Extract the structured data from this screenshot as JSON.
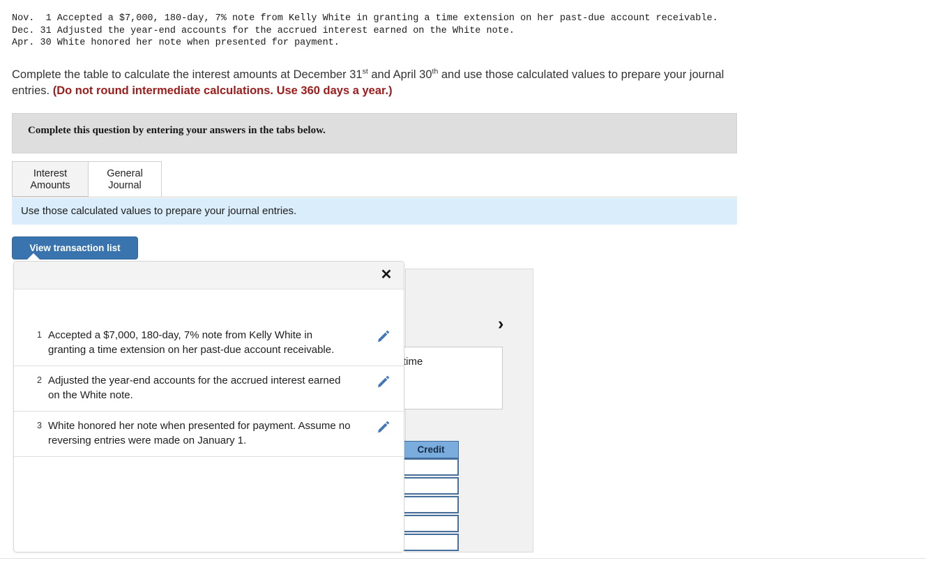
{
  "preamble": {
    "lines": [
      "Nov.  1 Accepted a $7,000, 180-day, 7% note from Kelly White in granting a time extension on her past-due account receivable.",
      "Dec. 31 Adjusted the year-end accounts for the accrued interest earned on the White note.",
      "Apr. 30 White honored her note when presented for payment."
    ],
    "full_text": "Nov.  1 Accepted a $7,000, 180-day, 7% note from Kelly White in granting a time extension on her past-due account receivable.\nDec. 31 Adjusted the year-end accounts for the accrued interest earned on the White note.\nApr. 30 White honored her note when presented for payment."
  },
  "instruction": {
    "part1": "Complete the table to calculate the interest amounts at December 31",
    "sup1": "st",
    "part2": " and April 30",
    "sup2": "th",
    "part3": " and use those calculated values to prepare your journal entries. ",
    "warning": "(Do not round intermediate calculations. Use 360 days a year.)"
  },
  "gray_callout": {
    "text": "Complete this question by entering your answers in the tabs below."
  },
  "tabs": [
    {
      "line1": "Interest",
      "line2": "Amounts",
      "active": false
    },
    {
      "line1": "General",
      "line2": "Journal",
      "active": true
    }
  ],
  "blue_bar": {
    "text": "Use those calculated values to prepare your journal entries."
  },
  "view_button": {
    "label": "View transaction list"
  },
  "popup": {
    "close_label": "✕",
    "transactions": [
      {
        "number": "1",
        "description": "Accepted a $7,000, 180-day, 7% note from Kelly White in granting a time extension on her past-due account receivable.",
        "edit_label": "edit"
      },
      {
        "number": "2",
        "description": "Adjusted the year-end accounts for the accrued interest earned on the White note.",
        "edit_label": "edit"
      },
      {
        "number": "3",
        "description": "White honored her note when presented for payment. Assume no reversing entries were made on January 1.",
        "edit_label": "edit"
      }
    ]
  },
  "journal_panel": {
    "chevron": "›",
    "textbox_value": "time",
    "credit_header": "Credit",
    "credit_cell_count": 5,
    "credit_cells": [
      "",
      "",
      "",
      "",
      ""
    ]
  },
  "colors": {
    "accent_blue": "#3a74ae",
    "info_bar_blue": "#daedfa",
    "callout_gray": "#dedede",
    "warning_red": "#9e1b1b",
    "credit_header_blue": "#7aaddd",
    "cell_border_blue": "#46709b",
    "pencil_blue": "#4577b4"
  }
}
